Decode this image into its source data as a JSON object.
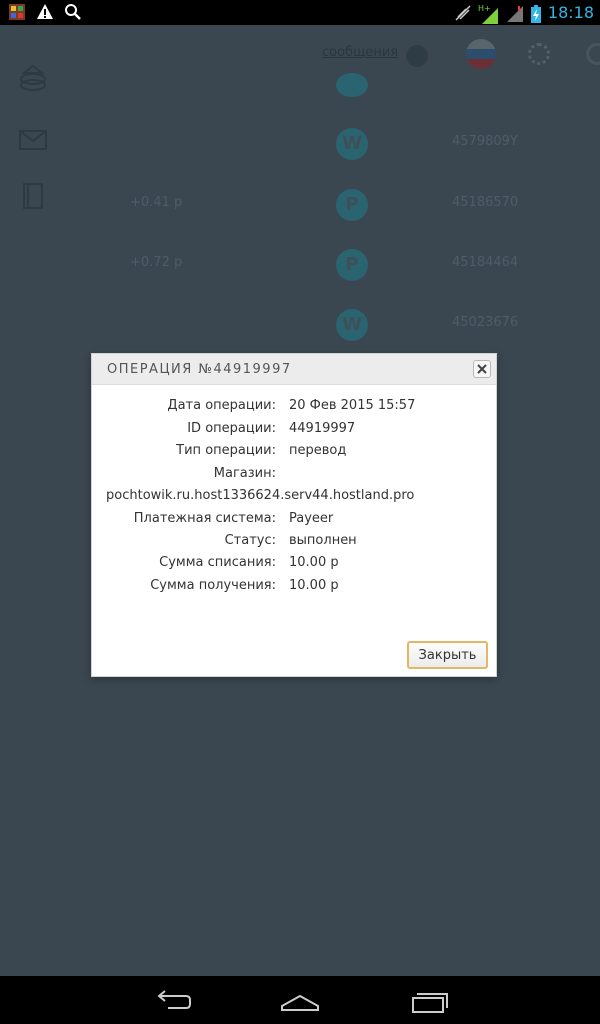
{
  "status_bar": {
    "time": "18:18",
    "icons": [
      "app-notification-icon",
      "warning-icon",
      "search-icon",
      "mute-icon",
      "signal-hplus-icon",
      "signal-icon",
      "battery-icon"
    ],
    "network_badge": "H+",
    "time_color": "#33b5e5"
  },
  "background": {
    "header": {
      "messages_label": "сообщения"
    },
    "rows": [
      {
        "amount": "",
        "order_id": "",
        "coin": "webmoney-icon"
      },
      {
        "amount": "",
        "order_id": "4579809Y",
        "coin": "webmoney-icon"
      },
      {
        "amount": "+0.41 р",
        "order_id": "45186570",
        "coin": "payeer-icon"
      },
      {
        "amount": "+0.72 р",
        "order_id": "45184464",
        "coin": "payeer-icon"
      },
      {
        "amount": "",
        "order_id": "45023676",
        "coin": "webmoney-icon"
      }
    ],
    "dim_color": "#3b4750"
  },
  "dialog": {
    "title": "ОПЕРАЦИЯ №44919997",
    "fields": [
      {
        "label": "Дата операции:",
        "value": "20 Фев 2015 15:57"
      },
      {
        "label": "ID операции:",
        "value": "44919997"
      },
      {
        "label": "Тип операции:",
        "value": "перевод"
      },
      {
        "label": "Магазин:",
        "value": ""
      }
    ],
    "shop_url": "pochtowik.ru.host1336624.serv44.hostland.pro",
    "fields2": [
      {
        "label": "Платежная система:",
        "value": "Payeer"
      },
      {
        "label": "Статус:",
        "value": "выполнен"
      },
      {
        "label": "Сумма списания:",
        "value": "10.00 р"
      },
      {
        "label": "Сумма получения:",
        "value": "10.00 р"
      }
    ],
    "close_button": "Закрыть",
    "accent": "#e5b765"
  },
  "nav_bar": {
    "buttons": [
      "back-icon",
      "home-icon",
      "recent-apps-icon"
    ]
  }
}
